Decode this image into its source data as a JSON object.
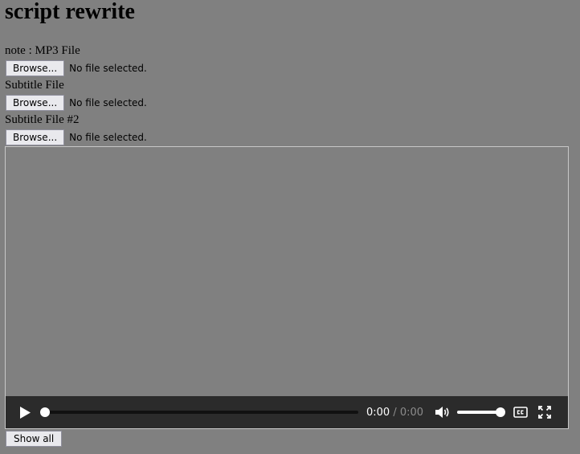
{
  "page": {
    "title": "script rewrite"
  },
  "uploads": [
    {
      "label": "note : MP3 File",
      "button_label": "Browse...",
      "status": "No file selected."
    },
    {
      "label": "Subtitle File",
      "button_label": "Browse...",
      "status": "No file selected."
    },
    {
      "label": "Subtitle File #2",
      "button_label": "Browse...",
      "status": "No file selected."
    }
  ],
  "player": {
    "current_time": "0:00",
    "separator": "/",
    "duration": "0:00",
    "progress": 0,
    "volume": 1.0,
    "icons": [
      "play-icon",
      "volume-icon",
      "closed-captions-icon",
      "fullscreen-icon"
    ]
  },
  "show_all_label": "Show all"
}
